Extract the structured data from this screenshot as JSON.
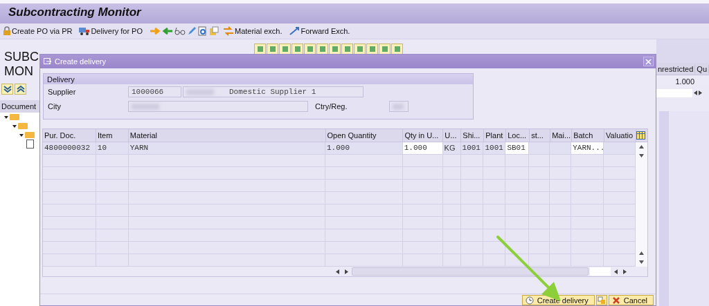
{
  "window": {
    "title": "Subcontracting Monitor"
  },
  "toolbar": [
    {
      "label": "Create PO via PR"
    },
    {
      "label": "Delivery for PO"
    },
    {
      "label": "Material exch."
    },
    {
      "label": "Forward Exch."
    }
  ],
  "monitor": {
    "heading": [
      "SUBC",
      "MON"
    ],
    "tree_header": "Document",
    "right_columns": [
      "nrestricted",
      "Qu"
    ],
    "right_value": "1.000"
  },
  "dialog": {
    "title": "Create delivery",
    "group": {
      "title": "Delivery",
      "supplier_label": "Supplier",
      "supplier_id": "1000066",
      "supplier_name": "Domestic Supplier 1",
      "city_label": "City",
      "country_label": "Ctry/Reg."
    },
    "table": {
      "columns": [
        "Pur. Doc.",
        "Item",
        "Material",
        "Open Quantity",
        "Qty in U...",
        "U...",
        "Shi...",
        "Plant",
        "Loc...",
        "st...",
        "Mai...",
        "Batch",
        "Valuatio"
      ],
      "rows": [
        [
          {
            "text": "4800000032",
            "editable": false
          },
          {
            "text": "10",
            "editable": false
          },
          {
            "text": "YARN",
            "editable": false
          },
          {
            "text": "1.000",
            "editable": false
          },
          {
            "text": "1.000",
            "editable": true
          },
          {
            "text": "KG",
            "editable": false
          },
          {
            "text": "1001",
            "editable": false
          },
          {
            "text": "1001",
            "editable": false
          },
          {
            "text": "SB01",
            "editable": true
          },
          {
            "editable": false
          },
          {
            "editable": false
          },
          {
            "text": "YARN...",
            "editable": true
          },
          {
            "editable": false
          }
        ]
      ]
    },
    "buttons": [
      {
        "label": "Create delivery",
        "kind": "confirm"
      },
      {
        "kind": "icon"
      },
      {
        "label": "Cancel",
        "kind": "cancel"
      }
    ]
  }
}
